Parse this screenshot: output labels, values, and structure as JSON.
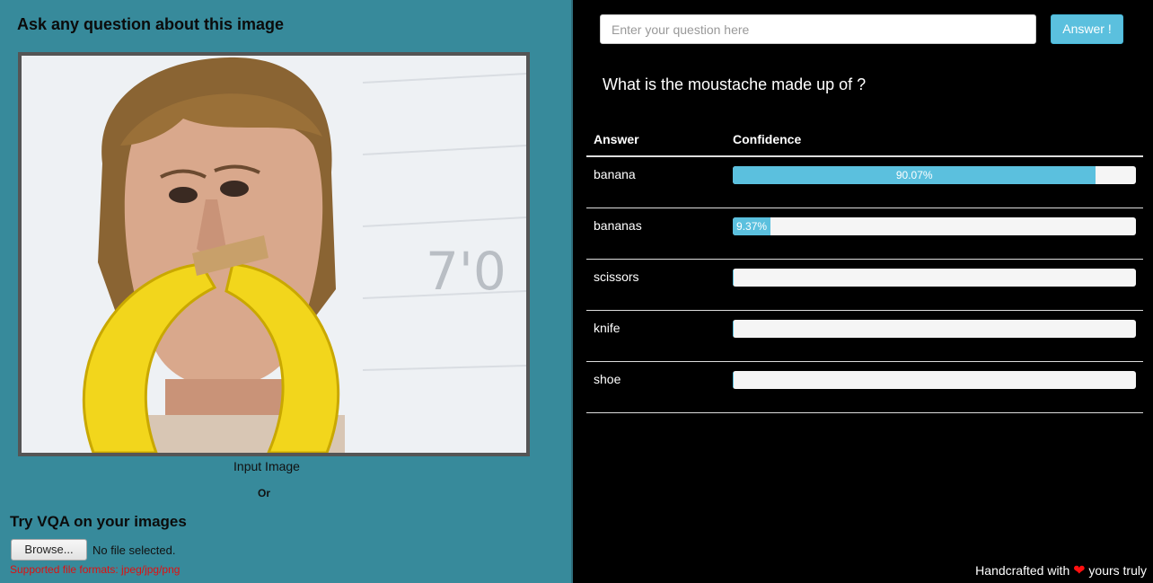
{
  "left": {
    "title": "Ask any question about this image",
    "image_caption": "Input Image",
    "or_text": "Or",
    "upload_title": "Try VQA on your images",
    "browse_label": "Browse...",
    "file_status": "No file selected.",
    "formats_note": "Supported file formats: jpeg/jpg/png"
  },
  "right": {
    "question_placeholder": "Enter your question here",
    "answer_button": "Answer !",
    "question": "What is the moustache made up of ?",
    "col_answer": "Answer",
    "col_confidence": "Confidence",
    "results": [
      {
        "answer": "banana",
        "confidence": 90.07,
        "label": "90.07%"
      },
      {
        "answer": "bananas",
        "confidence": 9.37,
        "label": "9.37%"
      },
      {
        "answer": "scissors",
        "confidence": 0.12,
        "label": ""
      },
      {
        "answer": "knife",
        "confidence": 0.11,
        "label": ""
      },
      {
        "answer": "shoe",
        "confidence": 0.08,
        "label": ""
      }
    ],
    "footer_pre": "Handcrafted with",
    "footer_post": "yours truly"
  },
  "colors": {
    "left_bg": "#378a9b",
    "accent": "#5bc0de",
    "error": "#e01010",
    "heart": "#ff1010"
  }
}
